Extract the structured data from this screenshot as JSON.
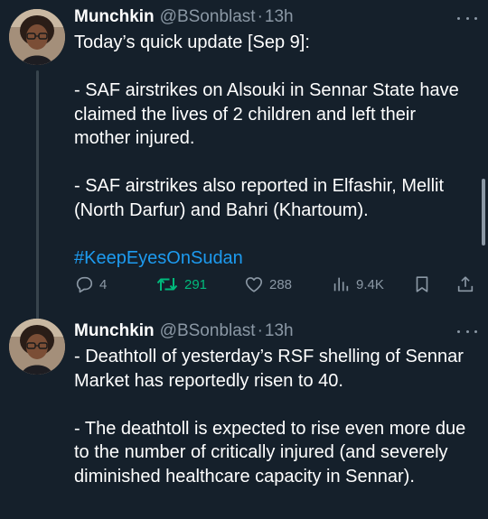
{
  "tweets": [
    {
      "author": {
        "name": "Munchkin",
        "handle": "@BSonblast",
        "separator": "·",
        "time": "13h"
      },
      "paragraphs": [
        "Today’s quick update [Sep 9]:",
        "- SAF airstrikes on Alsouki in Sennar State have claimed the lives of 2 children and left their mother injured.",
        "- SAF airstrikes also reported in Elfashir, Mellit (North Darfur) and Bahri (Khartoum)."
      ],
      "hashtag": "#KeepEyesOnSudan",
      "actions": {
        "reply_count": "4",
        "retweet_count": "291",
        "like_count": "288",
        "views_count": "9.4K"
      }
    },
    {
      "author": {
        "name": "Munchkin",
        "handle": "@BSonblast",
        "separator": "·",
        "time": "13h"
      },
      "paragraphs": [
        "- Deathtoll of yesterday’s  RSF shelling of Sennar Market has reportedly risen to 40.",
        "- The deathtoll is expected to rise even more due to the number of critically injured (and severely diminished healthcare capacity in Sennar)."
      ]
    }
  ],
  "icons": {
    "reply": "reply-icon",
    "retweet": "retweet-icon",
    "like": "heart-icon",
    "views": "views-icon",
    "bookmark": "bookmark-icon",
    "share": "share-icon",
    "more": "more-icon"
  },
  "colors": {
    "background": "#15202b",
    "text": "#ffffff",
    "muted": "#8b98a5",
    "link": "#1d9bf0",
    "retweet_active": "#00ba7c"
  }
}
